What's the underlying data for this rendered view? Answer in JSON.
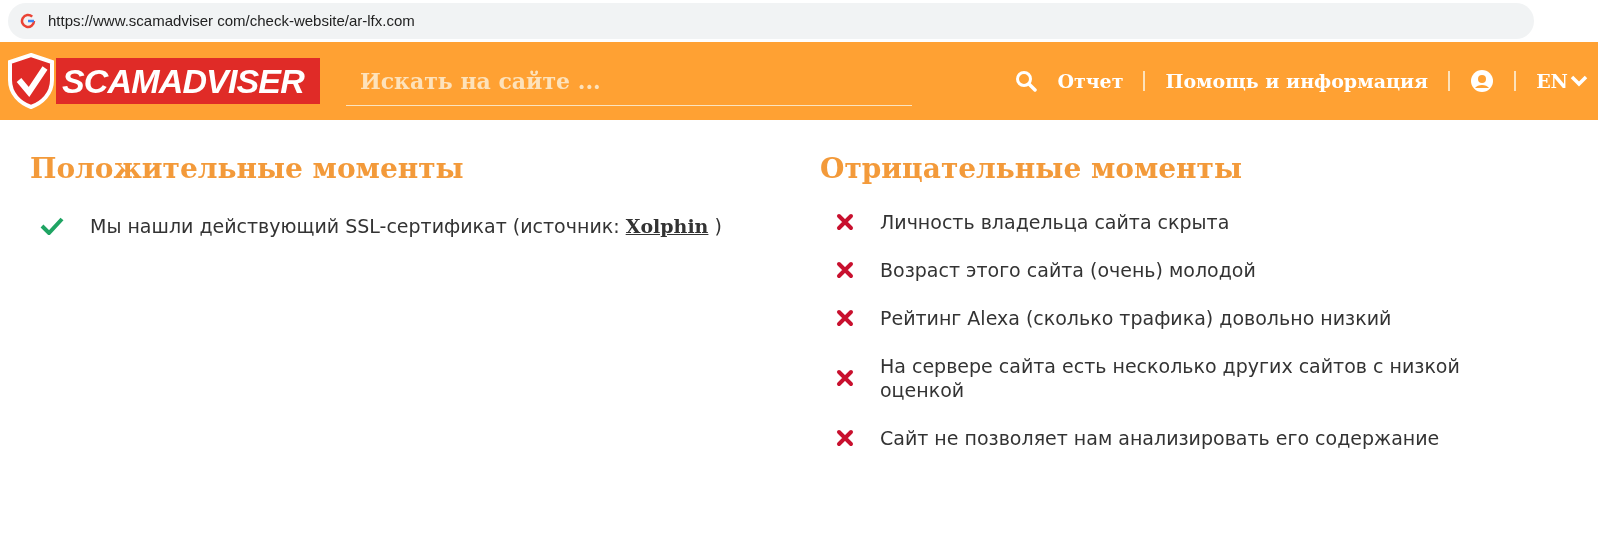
{
  "address_bar": {
    "url": "https://www.scamadviser com/check-website/ar-lfx.com"
  },
  "header": {
    "logo": "SCAMADVISER",
    "search": {
      "placeholder": "Искать на сайте ..."
    },
    "nav": [
      "Отчет",
      "Помощь и информация"
    ],
    "language": "EN"
  },
  "positive": {
    "title": "Положительные моменты",
    "items": [
      {
        "text": "Мы нашли действующий SSL-сертификат (источник: ",
        "link": "Xolphin",
        "after": " )"
      }
    ]
  },
  "negative": {
    "title": "Отрицательные моменты",
    "items": [
      {
        "text": "Личность владельца сайта скрыта"
      },
      {
        "text": "Возраст этого сайта (очень) молодой"
      },
      {
        "text": "Рейтинг Alexa (сколько трафика) довольно низкий"
      },
      {
        "text": "На сервере сайта есть несколько других сайтов с низкой оценкой"
      },
      {
        "text": "Сайт не позволяет нам анализировать его содержание"
      }
    ]
  }
}
